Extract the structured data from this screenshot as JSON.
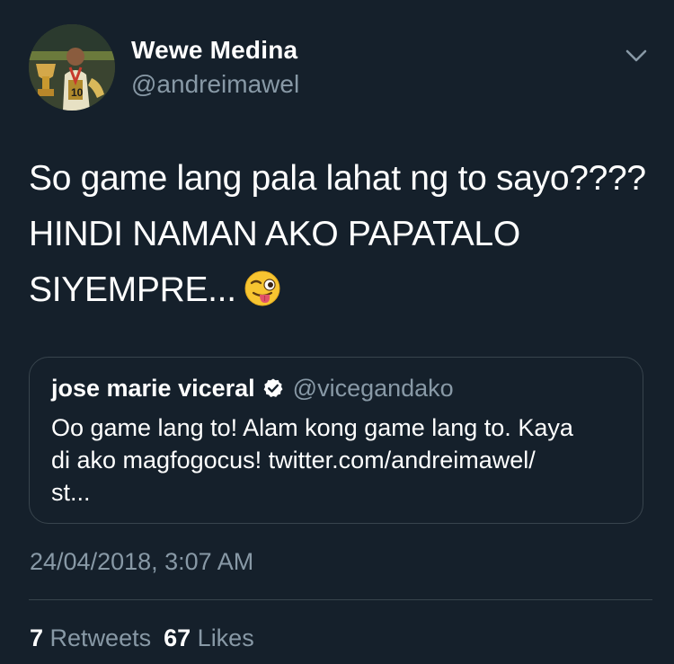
{
  "author": {
    "display_name": "Wewe Medina",
    "handle": "@andreimawel",
    "avatar_icon": "profile-photo"
  },
  "menu_icon": "chevron-down-icon",
  "tweet": {
    "lines": [
      "So game lang pala lahat ng to sayo????",
      "HINDI NAMAN AKO PAPATALO",
      "SIYEMPRE..."
    ],
    "emoji": "winking-face-with-tongue"
  },
  "quoted_tweet": {
    "name": "jose marie viceral",
    "verified": true,
    "handle": "@vicegandako",
    "lines": [
      "Oo game lang to! Alam kong game lang to. Kaya",
      "di ako magfogocus! twitter.com/andreimawel/",
      "st..."
    ]
  },
  "timestamp": "24/04/2018, 3:07 AM",
  "stats": {
    "retweets_count": "7",
    "retweets_label": "Retweets",
    "likes_count": "67",
    "likes_label": "Likes"
  },
  "colors": {
    "background": "#15202b",
    "primary_text": "#ffffff",
    "secondary_text": "#8899a6",
    "border": "#38444d"
  }
}
